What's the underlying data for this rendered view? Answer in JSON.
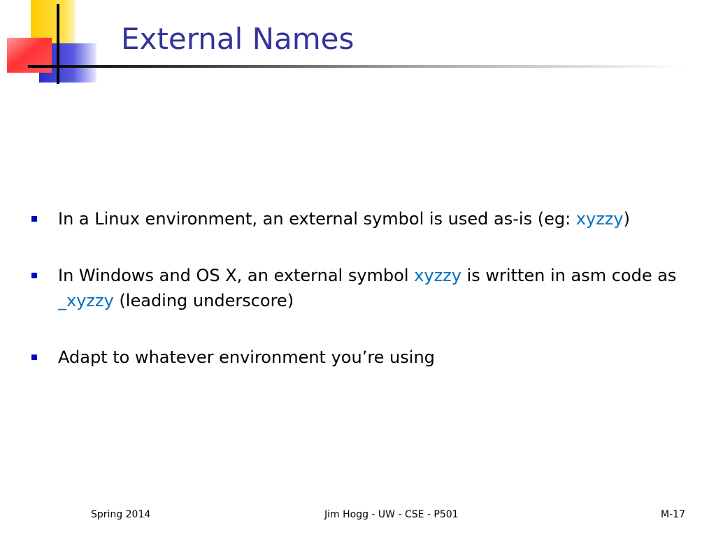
{
  "slide": {
    "title": "External Names",
    "colors": {
      "title": "#333399",
      "bullet_marker": "#0000cc",
      "code_text": "#0070c0",
      "logo_yellow": "#ffcc00",
      "logo_blue": "#3333cc",
      "logo_red": "#ff3333"
    },
    "logo_icon": "decorative-squares-logo",
    "bullets": [
      {
        "text_before": "In a Linux environment, an external symbol is used as-is (eg: ",
        "code": "xyzzy",
        "text_after": ")"
      },
      {
        "text_before": "In Windows and OS X, an external symbol ",
        "code": "xyzzy",
        "text_middle": " is written in asm code as ",
        "code2": "_xyzzy",
        "text_after": " (leading underscore)"
      },
      {
        "text": "Adapt to whatever environment you’re using"
      }
    ]
  },
  "footer": {
    "left": "Spring 2014",
    "center": "Jim Hogg - UW - CSE - P501",
    "right": "M-17"
  }
}
